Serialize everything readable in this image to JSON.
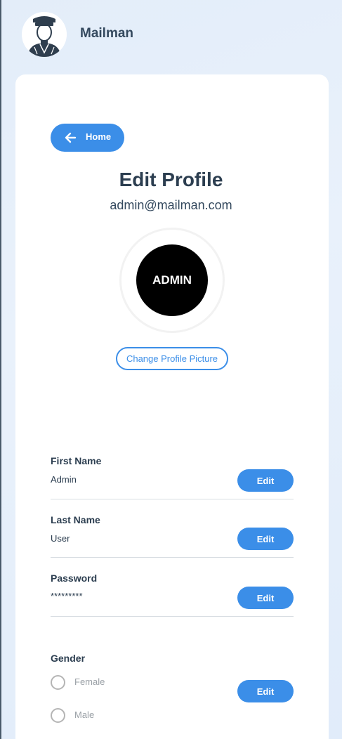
{
  "app": {
    "title": "Mailman",
    "logo_icon": "mailman-avatar-icon"
  },
  "nav": {
    "home_label": "Home",
    "home_icon": "arrow-left-icon"
  },
  "profile": {
    "title": "Edit Profile",
    "email": "admin@mailman.com",
    "avatar_text": "ADMIN",
    "change_picture_label": "Change Profile Picture"
  },
  "fields": {
    "first_name": {
      "label": "First Name",
      "value": "Admin",
      "edit_label": "Edit"
    },
    "last_name": {
      "label": "Last Name",
      "value": "User",
      "edit_label": "Edit"
    },
    "password": {
      "label": "Password",
      "value": "*********",
      "edit_label": "Edit"
    },
    "gender": {
      "label": "Gender",
      "options": [
        "Female",
        "Male"
      ],
      "edit_label": "Edit"
    }
  },
  "colors": {
    "accent": "#3b8ee8",
    "text_dark": "#2c3e50",
    "avatar_bg": "#000000"
  }
}
